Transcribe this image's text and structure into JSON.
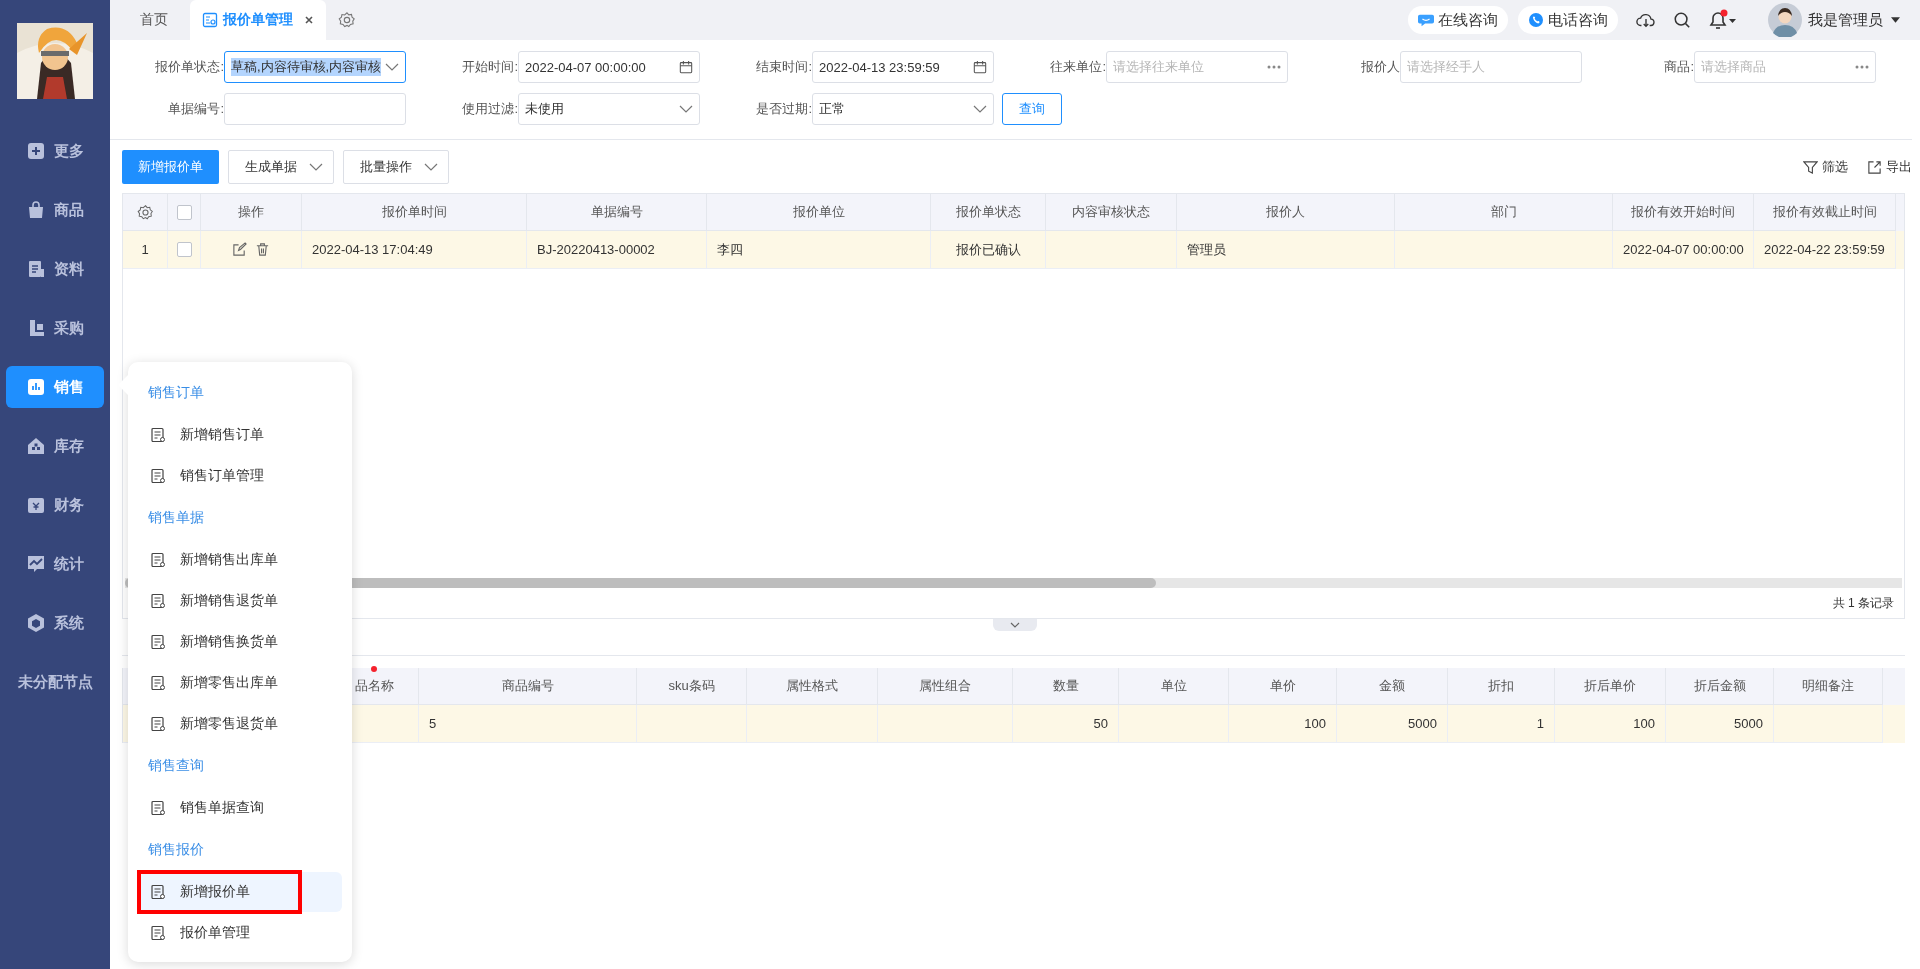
{
  "sidebar": {
    "items": [
      {
        "label": "更多",
        "selected": false
      },
      {
        "label": "商品",
        "selected": false
      },
      {
        "label": "资料",
        "selected": false
      },
      {
        "label": "采购",
        "selected": false
      },
      {
        "label": "销售",
        "selected": true
      },
      {
        "label": "库存",
        "selected": false
      },
      {
        "label": "财务",
        "selected": false
      },
      {
        "label": "统计",
        "selected": false
      },
      {
        "label": "系统",
        "selected": false
      },
      {
        "label": "未分配节点",
        "selected": false
      }
    ]
  },
  "tabs": [
    {
      "label": "首页",
      "selected": false
    },
    {
      "label": "报价单管理",
      "selected": true
    }
  ],
  "header": {
    "online_consult": "在线咨询",
    "phone_consult": "电话咨询",
    "notification_dot": true,
    "user": "我是管理员"
  },
  "filters": [
    {
      "label": "报价单状态:",
      "kind": "select",
      "value": "草稿,内容待审核,内容审核",
      "focused": true
    },
    {
      "label": "开始时间:",
      "kind": "date",
      "value": "2022-04-07 00:00:00",
      "focused": false
    },
    {
      "label": "结束时间:",
      "kind": "date",
      "value": "2022-04-13 23:59:59",
      "focused": false
    },
    {
      "label": "往来单位:",
      "kind": "picker",
      "placeholder": "请选择往来单位",
      "focused": false
    },
    {
      "label": "报价人",
      "kind": "text",
      "placeholder": "请选择经手人",
      "focused": false
    },
    {
      "label": "商品:",
      "kind": "picker",
      "placeholder": "请选择商品",
      "focused": false
    },
    {
      "label": "单据编号:",
      "kind": "text",
      "focused": false
    },
    {
      "label": "使用过滤:",
      "kind": "select",
      "value": "未使用",
      "focused": false
    },
    {
      "label": "是否过期:",
      "kind": "select",
      "value": "正常",
      "focused": false
    }
  ],
  "query_button": "查询",
  "toolbar": {
    "primary": "新增报价单",
    "dropdowns": [
      "生成单据",
      "批量操作"
    ],
    "filter": "筛选",
    "export": "导出"
  },
  "table": {
    "columns": [
      "操作",
      "报价单时间",
      "单据编号",
      "报价单位",
      "报价单状态",
      "内容审核状态",
      "报价人",
      "部门",
      "报价有效开始时间",
      "报价有效截止时间"
    ],
    "all_checked": false,
    "rows": [
      {
        "index": "1",
        "checked": false,
        "cells": [
          "",
          "2022-04-13 17:04:49",
          "BJ-20220413-00002",
          "李四",
          "报价已确认",
          "",
          "管理员",
          "",
          "2022-04-07 00:00:00",
          "2022-04-22 23:59:59"
        ]
      }
    ],
    "footer": "共 1 条记录"
  },
  "detail_table": {
    "columns": [
      {
        "label": "品名称",
        "required": true
      },
      {
        "label": "商品编号",
        "required": false
      },
      {
        "label": "sku条码",
        "required": false
      },
      {
        "label": "属性格式",
        "required": false
      },
      {
        "label": "属性组合",
        "required": false
      },
      {
        "label": "数量",
        "required": false
      },
      {
        "label": "单位",
        "required": false
      },
      {
        "label": "单价",
        "required": false
      },
      {
        "label": "金额",
        "required": false
      },
      {
        "label": "折扣",
        "required": false
      },
      {
        "label": "折后单价",
        "required": false
      },
      {
        "label": "折后金额",
        "required": false
      },
      {
        "label": "明细备注",
        "required": false
      }
    ],
    "rows": [
      {
        "cells": [
          "",
          "5",
          "",
          "",
          "",
          "50",
          "",
          "100",
          "5000",
          "1",
          "100",
          "5000",
          ""
        ]
      }
    ]
  },
  "popup": {
    "groups": [
      {
        "title": "销售订单",
        "items": [
          {
            "label": "新增销售订单",
            "highlighted": false
          },
          {
            "label": "销售订单管理",
            "highlighted": false
          }
        ]
      },
      {
        "title": "销售单据",
        "items": [
          {
            "label": "新增销售出库单",
            "highlighted": false
          },
          {
            "label": "新增销售退货单",
            "highlighted": false
          },
          {
            "label": "新增销售换货单",
            "highlighted": false
          },
          {
            "label": "新增零售出库单",
            "highlighted": false
          },
          {
            "label": "新增零售退货单",
            "highlighted": false
          }
        ]
      },
      {
        "title": "销售查询",
        "items": [
          {
            "label": "销售单据查询",
            "highlighted": false
          }
        ]
      },
      {
        "title": "销售报价",
        "items": [
          {
            "label": "新增报价单",
            "highlighted": true
          },
          {
            "label": "报价单管理",
            "highlighted": false
          }
        ]
      }
    ]
  }
}
